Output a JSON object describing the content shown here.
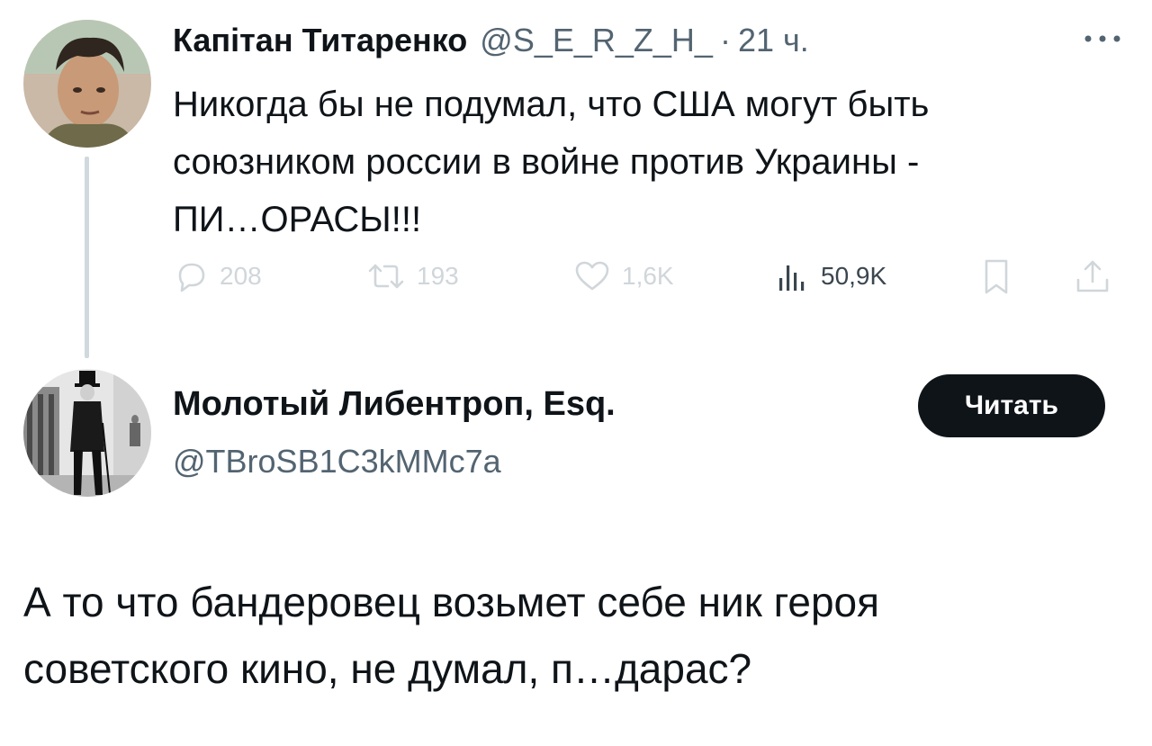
{
  "colors": {
    "text_primary": "#0f1419",
    "text_secondary": "#536471",
    "action_faded": "#d0d6da",
    "thread_line": "#cfd9de",
    "follow_button_bg": "#0f1419"
  },
  "tweet1": {
    "author_name": "Капiтан Титаренко",
    "handle": "@S_E_R_Z_H_",
    "separator": "·",
    "time": "21 ч.",
    "text": "Никогда бы не подумал, что США могут быть\nсоюзником россии в войне против Украины -\nПИ…ОРАСЫ!!!",
    "actions": {
      "reply_count": "208",
      "retweet_count": "193",
      "like_count": "1,6K",
      "views_count": "50,9K"
    },
    "icons": {
      "avatar": "avatar-photo",
      "more": "more-dots-icon",
      "reply": "reply-icon",
      "retweet": "retweet-icon",
      "like": "heart-icon",
      "views": "views-bar-chart-icon",
      "bookmark": "bookmark-icon",
      "share": "share-icon"
    }
  },
  "tweet2": {
    "author_name": "Молотый Либентроп, Esq.",
    "handle": "@TBroSB1C3kMMc7a",
    "follow_label": "Читать",
    "text": "А то что бандеровец возьмет себе ник героя\nсоветского кино, не думал, п…дарас?"
  }
}
